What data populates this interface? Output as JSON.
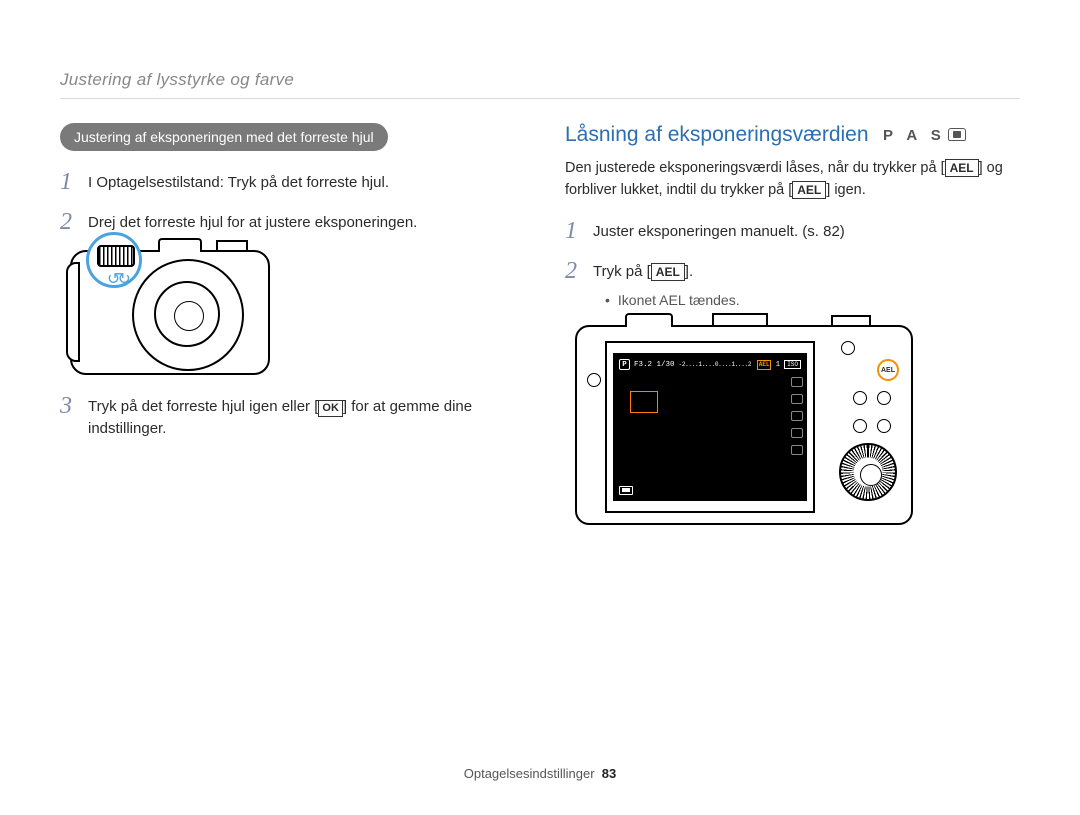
{
  "breadcrumb": "Justering af lysstyrke og farve",
  "left": {
    "pill": "Justering af eksponeringen med det forreste hjul",
    "steps": [
      {
        "n": "1",
        "text": "I Optagelsestilstand: Tryk på det forreste hjul."
      },
      {
        "n": "2",
        "text": "Drej det forreste hjul for at justere eksponeringen."
      },
      {
        "n": "3",
        "before": "Tryk på det forreste hjul igen eller [",
        "key": "OK",
        "after": "] for at gemme dine indstillinger."
      }
    ]
  },
  "right": {
    "heading": "Låsning af eksponeringsværdien",
    "modes": "P A S",
    "lead_before": "Den justerede eksponeringsværdi låses, når du trykker på [",
    "lead_mid": "] og forbliver lukket, indtil du trykker på [",
    "lead_after": "] igen.",
    "key": "AEL",
    "steps": [
      {
        "n": "1",
        "text": "Juster eksponeringen manuelt. (s. 82)"
      },
      {
        "n": "2",
        "before": "Tryk på [",
        "key": "AEL",
        "after": "].",
        "bullet": "Ikonet AEL tændes."
      }
    ],
    "osd": {
      "p": "P",
      "fs": "F3.2 1/30",
      "scale": "-2....1....0....1....2",
      "ael": "AEL",
      "one": "1",
      "iso": "ISO"
    },
    "ael_button": "AEL"
  },
  "footer": {
    "section": "Optagelsesindstillinger",
    "page": "83"
  }
}
